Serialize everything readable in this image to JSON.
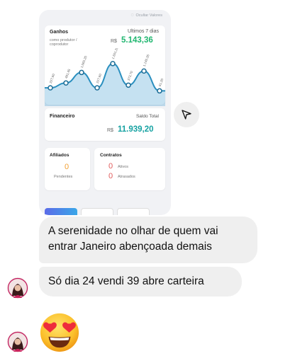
{
  "story": {
    "hide_values": "Ocultar Valores",
    "ganhos": {
      "title": "Ganhos",
      "subtitle": "como produtor / coprodutor",
      "period": "Ultimos 7 dias",
      "currency": "R$",
      "amount": "5.143,36"
    },
    "chart_data": {
      "type": "area",
      "title": "",
      "xlabel": "",
      "ylabel": "",
      "point_labels": [
        "227,60",
        "491,45",
        "1.065,20",
        "227,60",
        "1.551,25",
        "373,70",
        "1.145,35",
        "61,20"
      ],
      "values": [
        227.6,
        491.45,
        1065.2,
        227.6,
        1551.25,
        373.7,
        1145.35,
        61.2
      ],
      "ylim": [
        0,
        1700
      ],
      "colors": {
        "line": "#2a8fbf",
        "fill": "#5aa9d6",
        "points": "#1a6c96"
      }
    },
    "financeiro": {
      "title": "Financeiro",
      "label": "Saldo Total",
      "currency": "R$",
      "amount": "11.939,20"
    },
    "afiliados": {
      "title": "Afiliados",
      "count": "0",
      "label": "Pendentes"
    },
    "contratos": {
      "title": "Contratos",
      "items": [
        {
          "count": "0",
          "label": "Ativos"
        },
        {
          "count": "0",
          "label": "Atrasados"
        }
      ]
    }
  },
  "messages": [
    {
      "text": "A serenidade no olhar de quem vai entrar Janeiro abençoada demais"
    },
    {
      "text": "Só dia 24 vendi 39 abre carteira"
    }
  ],
  "icons": {
    "send": "paper-plane-icon",
    "emoji": "heart-eyes-emoji",
    "hide": "eye-slash-icon"
  },
  "colors": {
    "green": "#1fb66f",
    "teal": "#16a2a2",
    "orange": "#f2a033",
    "red": "#e25b5b",
    "bubble": "#efefef"
  }
}
